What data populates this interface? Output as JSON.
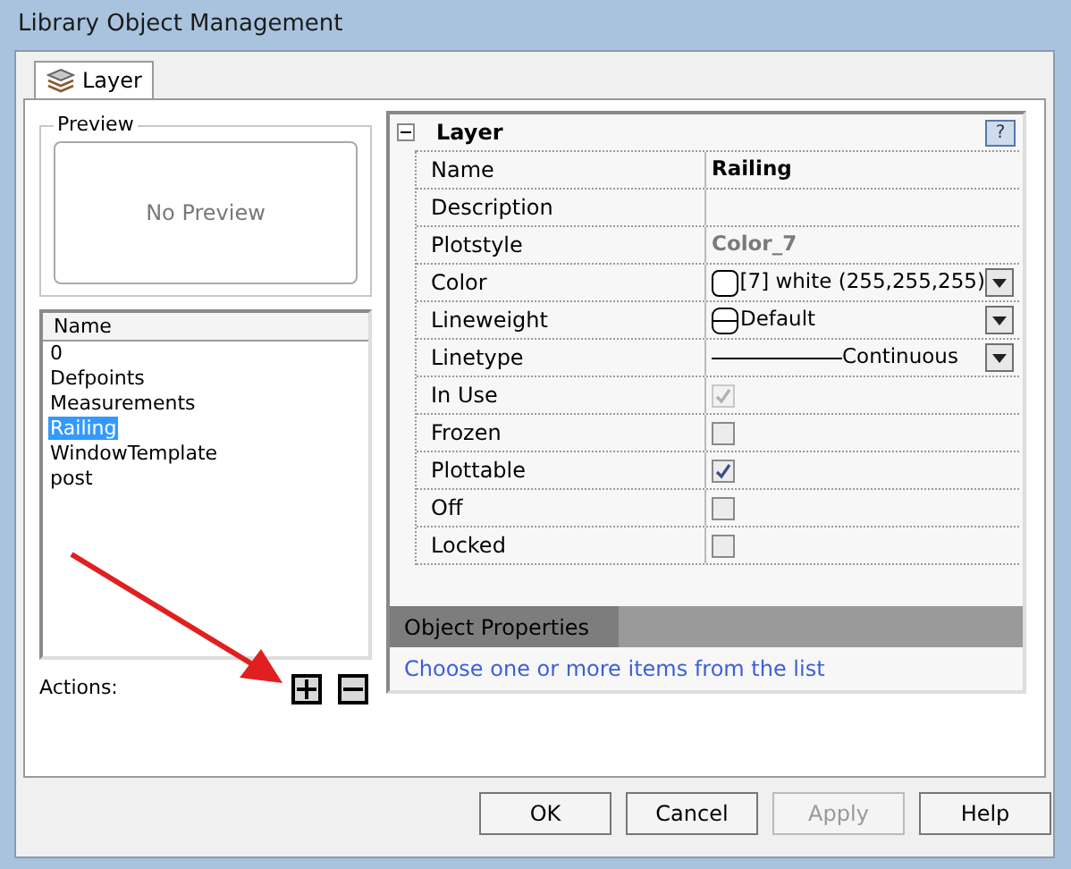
{
  "window": {
    "title": "Library Object Management"
  },
  "tabs": [
    {
      "label": "Layer",
      "selected": true
    }
  ],
  "preview": {
    "title": "Preview",
    "text": "No Preview"
  },
  "list": {
    "column": "Name",
    "items": [
      {
        "label": "0",
        "selected": false
      },
      {
        "label": "Defpoints",
        "selected": false
      },
      {
        "label": "Measurements",
        "selected": false
      },
      {
        "label": "Railing",
        "selected": true
      },
      {
        "label": "WindowTemplate",
        "selected": false
      },
      {
        "label": "post",
        "selected": false
      }
    ]
  },
  "actions": {
    "label": "Actions:"
  },
  "properties": {
    "title": "Layer",
    "expanded": true,
    "help": "?",
    "rows": [
      {
        "label": "Name",
        "kind": "bold",
        "value": "Railing"
      },
      {
        "label": "Description",
        "kind": "text",
        "value": ""
      },
      {
        "label": "Plotstyle",
        "kind": "muted",
        "value": "Color_7"
      },
      {
        "label": "Color",
        "kind": "color",
        "value": "[7] white (255,255,255)"
      },
      {
        "label": "Lineweight",
        "kind": "lineweight",
        "value": "Default"
      },
      {
        "label": "Linetype",
        "kind": "linetype",
        "value": "Continuous"
      },
      {
        "label": "In Use",
        "kind": "checkbox",
        "checked": true,
        "disabled": true
      },
      {
        "label": "Frozen",
        "kind": "checkbox",
        "checked": false,
        "disabled": false
      },
      {
        "label": "Plottable",
        "kind": "checkbox",
        "checked": true,
        "disabled": false
      },
      {
        "label": "Off",
        "kind": "checkbox",
        "checked": false,
        "disabled": false
      },
      {
        "label": "Locked",
        "kind": "checkbox",
        "checked": false,
        "disabled": false
      }
    ]
  },
  "object_properties": {
    "title": "Object Properties",
    "link": "Choose one or more items from the list"
  },
  "buttons": [
    {
      "label": "OK",
      "disabled": false
    },
    {
      "label": "Cancel",
      "disabled": false
    },
    {
      "label": "Apply",
      "disabled": true
    },
    {
      "label": "Help",
      "disabled": false
    }
  ]
}
